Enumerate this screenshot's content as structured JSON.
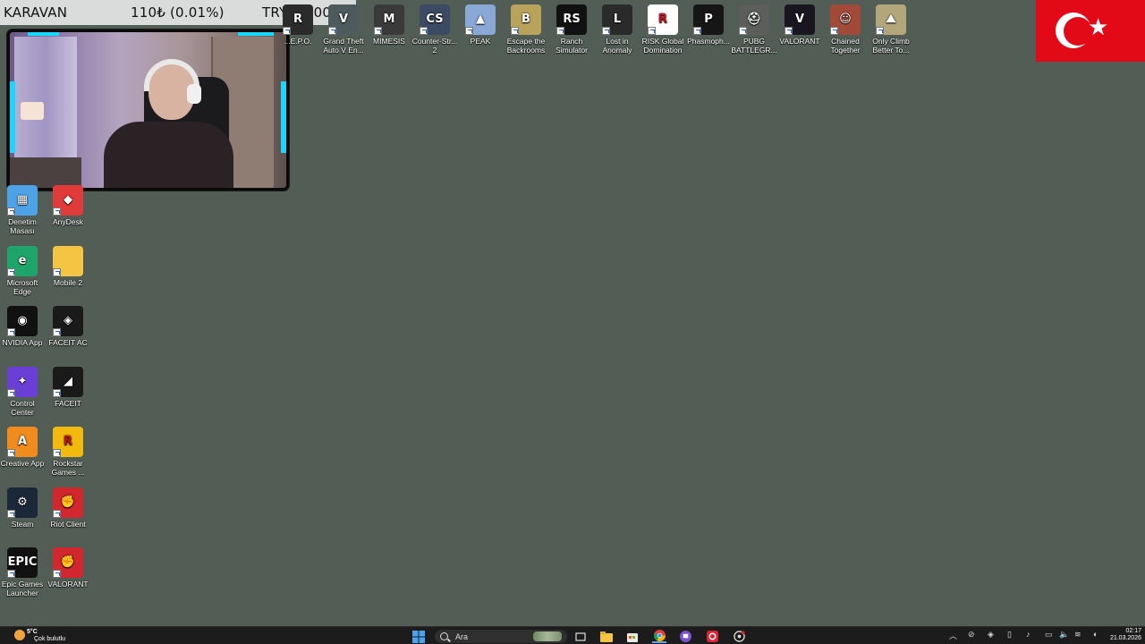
{
  "donation": {
    "name": "KARAVAN",
    "amount": "110₺ (0.01%)",
    "goal": "TRY1000000"
  },
  "desktop": {
    "top_row": [
      {
        "label": "...E.P.O.",
        "icon": "repo-icon",
        "color": "#2b2b2b",
        "glyph": "R"
      },
      {
        "label": "Grand Theft Auto V En...",
        "icon": "gta-icon",
        "color": "#4d5a5e",
        "glyph": "V"
      },
      {
        "label": "MIMESIS",
        "icon": "mimesis-icon",
        "color": "#3a3a3a",
        "glyph": "M"
      },
      {
        "label": "Counter-Str... 2",
        "icon": "counter-strike-icon",
        "color": "#3c4a63",
        "glyph": "CS"
      },
      {
        "label": "PEAK",
        "icon": "peak-icon",
        "color": "#8aa8d6",
        "glyph": "▲"
      },
      {
        "label": "Escape the Backrooms",
        "icon": "backrooms-icon",
        "color": "#b9a25a",
        "glyph": "B"
      },
      {
        "label": "Ranch Simulator",
        "icon": "ranch-simulator-icon",
        "color": "#111111",
        "glyph": "RS"
      },
      {
        "label": "Lost in Anomaly",
        "icon": "lost-in-anomaly-icon",
        "color": "#2a2a2a",
        "glyph": "L"
      },
      {
        "label": "RISK Global Domination",
        "icon": "risk-icon",
        "color": "#ffffff",
        "glyph": "R"
      },
      {
        "label": "Phasmoph...",
        "icon": "phasmophobia-icon",
        "color": "#161616",
        "glyph": "P"
      },
      {
        "label": "PUBG BATTLEGR...",
        "icon": "pubg-icon",
        "color": "#5b5e5b",
        "glyph": "⛑"
      },
      {
        "label": "VALORANT",
        "icon": "valorant-icon",
        "color": "#1a1620",
        "glyph": "V"
      },
      {
        "label": "Chained Together",
        "icon": "chained-together-icon",
        "color": "#a2493a",
        "glyph": "☺"
      },
      {
        "label": "Only Climb Better To...",
        "icon": "only-climb-icon",
        "color": "#b2a67a",
        "glyph": "⛰"
      }
    ],
    "left_col": [
      {
        "label": "Denetim Masası",
        "icon": "control-panel-icon",
        "color": "#4da3e6",
        "glyph": "▦"
      },
      {
        "label": "Microsoft Edge",
        "icon": "edge-icon",
        "color": "#1fa46b",
        "glyph": "e"
      },
      {
        "label": "NVIDIA App",
        "icon": "nvidia-icon",
        "color": "#111111",
        "glyph": "◉"
      },
      {
        "label": "Control Center",
        "icon": "control-center-icon",
        "color": "#6a3fd6",
        "glyph": "✦"
      },
      {
        "label": "Creative App",
        "icon": "creative-app-icon",
        "color": "#f08b1e",
        "glyph": "A"
      },
      {
        "label": "Steam",
        "icon": "steam-icon",
        "color": "#1b2838",
        "glyph": "⚙"
      },
      {
        "label": "Epic Games Launcher",
        "icon": "epic-games-icon",
        "color": "#111111",
        "glyph": "EPIC"
      }
    ],
    "right_col": [
      {
        "label": "AnyDesk",
        "icon": "anydesk-icon",
        "color": "#e03a3a",
        "glyph": "◆"
      },
      {
        "label": "Mobile 2",
        "icon": "folder-icon",
        "color": "#f4c542",
        "glyph": ""
      },
      {
        "label": "FACEIT AC",
        "icon": "faceit-ac-icon",
        "color": "#1a1a1a",
        "glyph": "◈"
      },
      {
        "label": "FACEIT",
        "icon": "faceit-icon",
        "color": "#1a1a1a",
        "glyph": "◢"
      },
      {
        "label": "Rockstar Games ...",
        "icon": "rockstar-icon",
        "color": "#f2b90f",
        "glyph": "R"
      },
      {
        "label": "Riot Client",
        "icon": "riot-client-icon",
        "color": "#d3272f",
        "glyph": "✊"
      },
      {
        "label": "VALORANT",
        "icon": "valorant-icon",
        "color": "#d3272f",
        "glyph": "✊"
      }
    ]
  },
  "taskbar": {
    "weather_temp": "5°C",
    "weather_desc": "Çok bulutlu",
    "search_placeholder": "Ara",
    "apps": [
      "windows-start-icon",
      "task-view-icon",
      "file-explorer-icon",
      "store-icon",
      "chrome-icon",
      "twitch-icon",
      "opera-icon",
      "obs-icon"
    ],
    "time": "02:17",
    "date": "21.03.2026"
  }
}
